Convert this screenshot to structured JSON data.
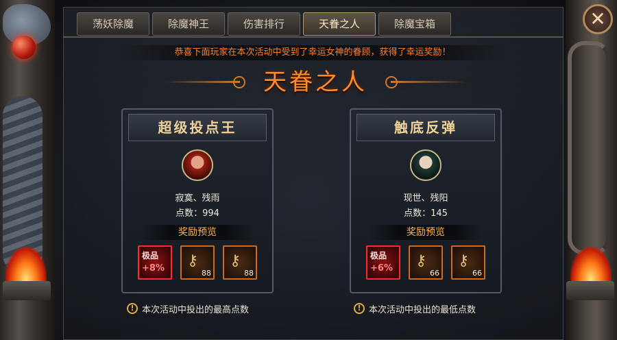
{
  "tabs": [
    {
      "label": "荡妖除魔",
      "active": false
    },
    {
      "label": "除魔神王",
      "active": false
    },
    {
      "label": "伤害排行",
      "active": false
    },
    {
      "label": "天眷之人",
      "active": true
    },
    {
      "label": "除魔宝箱",
      "active": false
    }
  ],
  "close_icon": "close-icon",
  "notice": "恭喜下面玩家在本次活动中受到了幸运女神的眷顾，获得了幸运奖励！",
  "title": "天眷之人",
  "cards": [
    {
      "heading": "超级投点王",
      "player_name": "寂寞、残雨",
      "score_text": "点数：994",
      "reward_heading": "奖励预览",
      "items": [
        {
          "type": "boost",
          "badge": "极品",
          "percent": "+8%"
        },
        {
          "type": "key",
          "icon": "key-icon",
          "count": "88"
        },
        {
          "type": "key",
          "icon": "key-icon",
          "count": "88"
        }
      ],
      "footnote": "本次活动中投出的最高点数"
    },
    {
      "heading": "触底反弹",
      "player_name": "现世、残阳",
      "score_text": "点数：145",
      "reward_heading": "奖励预览",
      "items": [
        {
          "type": "boost",
          "badge": "极品",
          "percent": "+6%"
        },
        {
          "type": "key",
          "icon": "key-icon",
          "count": "66"
        },
        {
          "type": "key",
          "icon": "key-icon",
          "count": "66"
        }
      ],
      "footnote": "本次活动中投出的最低点数"
    }
  ],
  "colors": {
    "accent": "#ff8a2a",
    "notice": "#ff7f2a",
    "reward": "#ffb450"
  }
}
